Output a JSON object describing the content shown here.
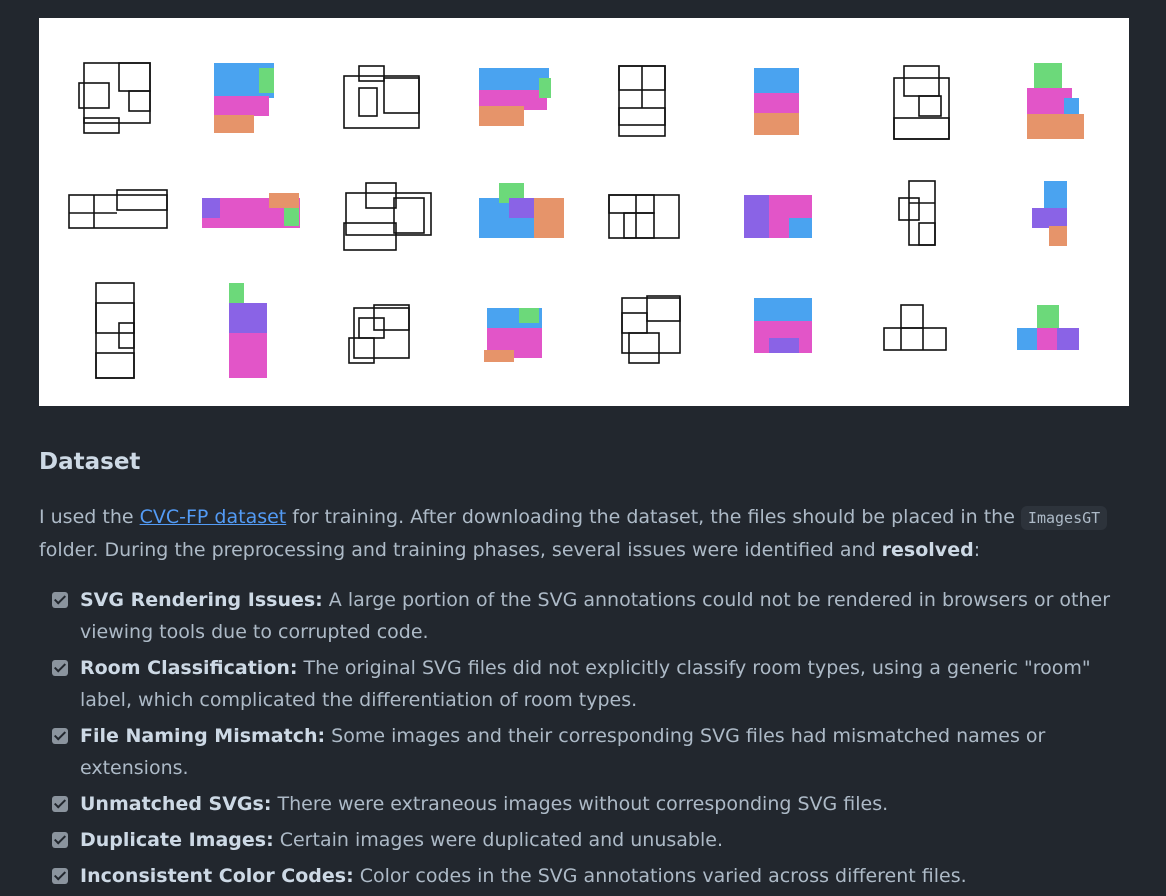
{
  "heading": "Dataset",
  "intro": {
    "prefix": "I used the ",
    "link": "CVC-FP dataset",
    "mid": " for training. After downloading the dataset, the files should be placed in the ",
    "code": "ImagesGT",
    "mid2": " folder. During the preprocessing and training phases, several issues were identified and ",
    "bold": "resolved",
    "suffix": ":"
  },
  "tasks": [
    {
      "title": "SVG Rendering Issues:",
      "text": " A large portion of the SVG annotations could not be rendered in browsers or other viewing tools due to corrupted code.",
      "checked": true
    },
    {
      "title": "Room Classification:",
      "text": " The original SVG files did not explicitly classify room types, using a generic \"room\" label, which complicated the differentiation of room types.",
      "checked": true
    },
    {
      "title": "File Naming Mismatch:",
      "text": " Some images and their corresponding SVG files had mismatched names or extensions.",
      "checked": true
    },
    {
      "title": "Unmatched SVGs:",
      "text": " There were extraneous images without corresponding SVG files.",
      "checked": true
    },
    {
      "title": "Duplicate Images:",
      "text": " Certain images were duplicated and unusable.",
      "checked": true
    },
    {
      "title": "Inconsistent Color Codes:",
      "text": " Color codes in the SVG annotations varied across different files.",
      "checked": true
    }
  ],
  "colors": {
    "background": "#22272e",
    "link": "#539bf5",
    "pink": "#e255c8",
    "blue": "#4aa3f0",
    "orange": "#e6946a",
    "green": "#6cd97a",
    "purple": "#8a63e6"
  }
}
